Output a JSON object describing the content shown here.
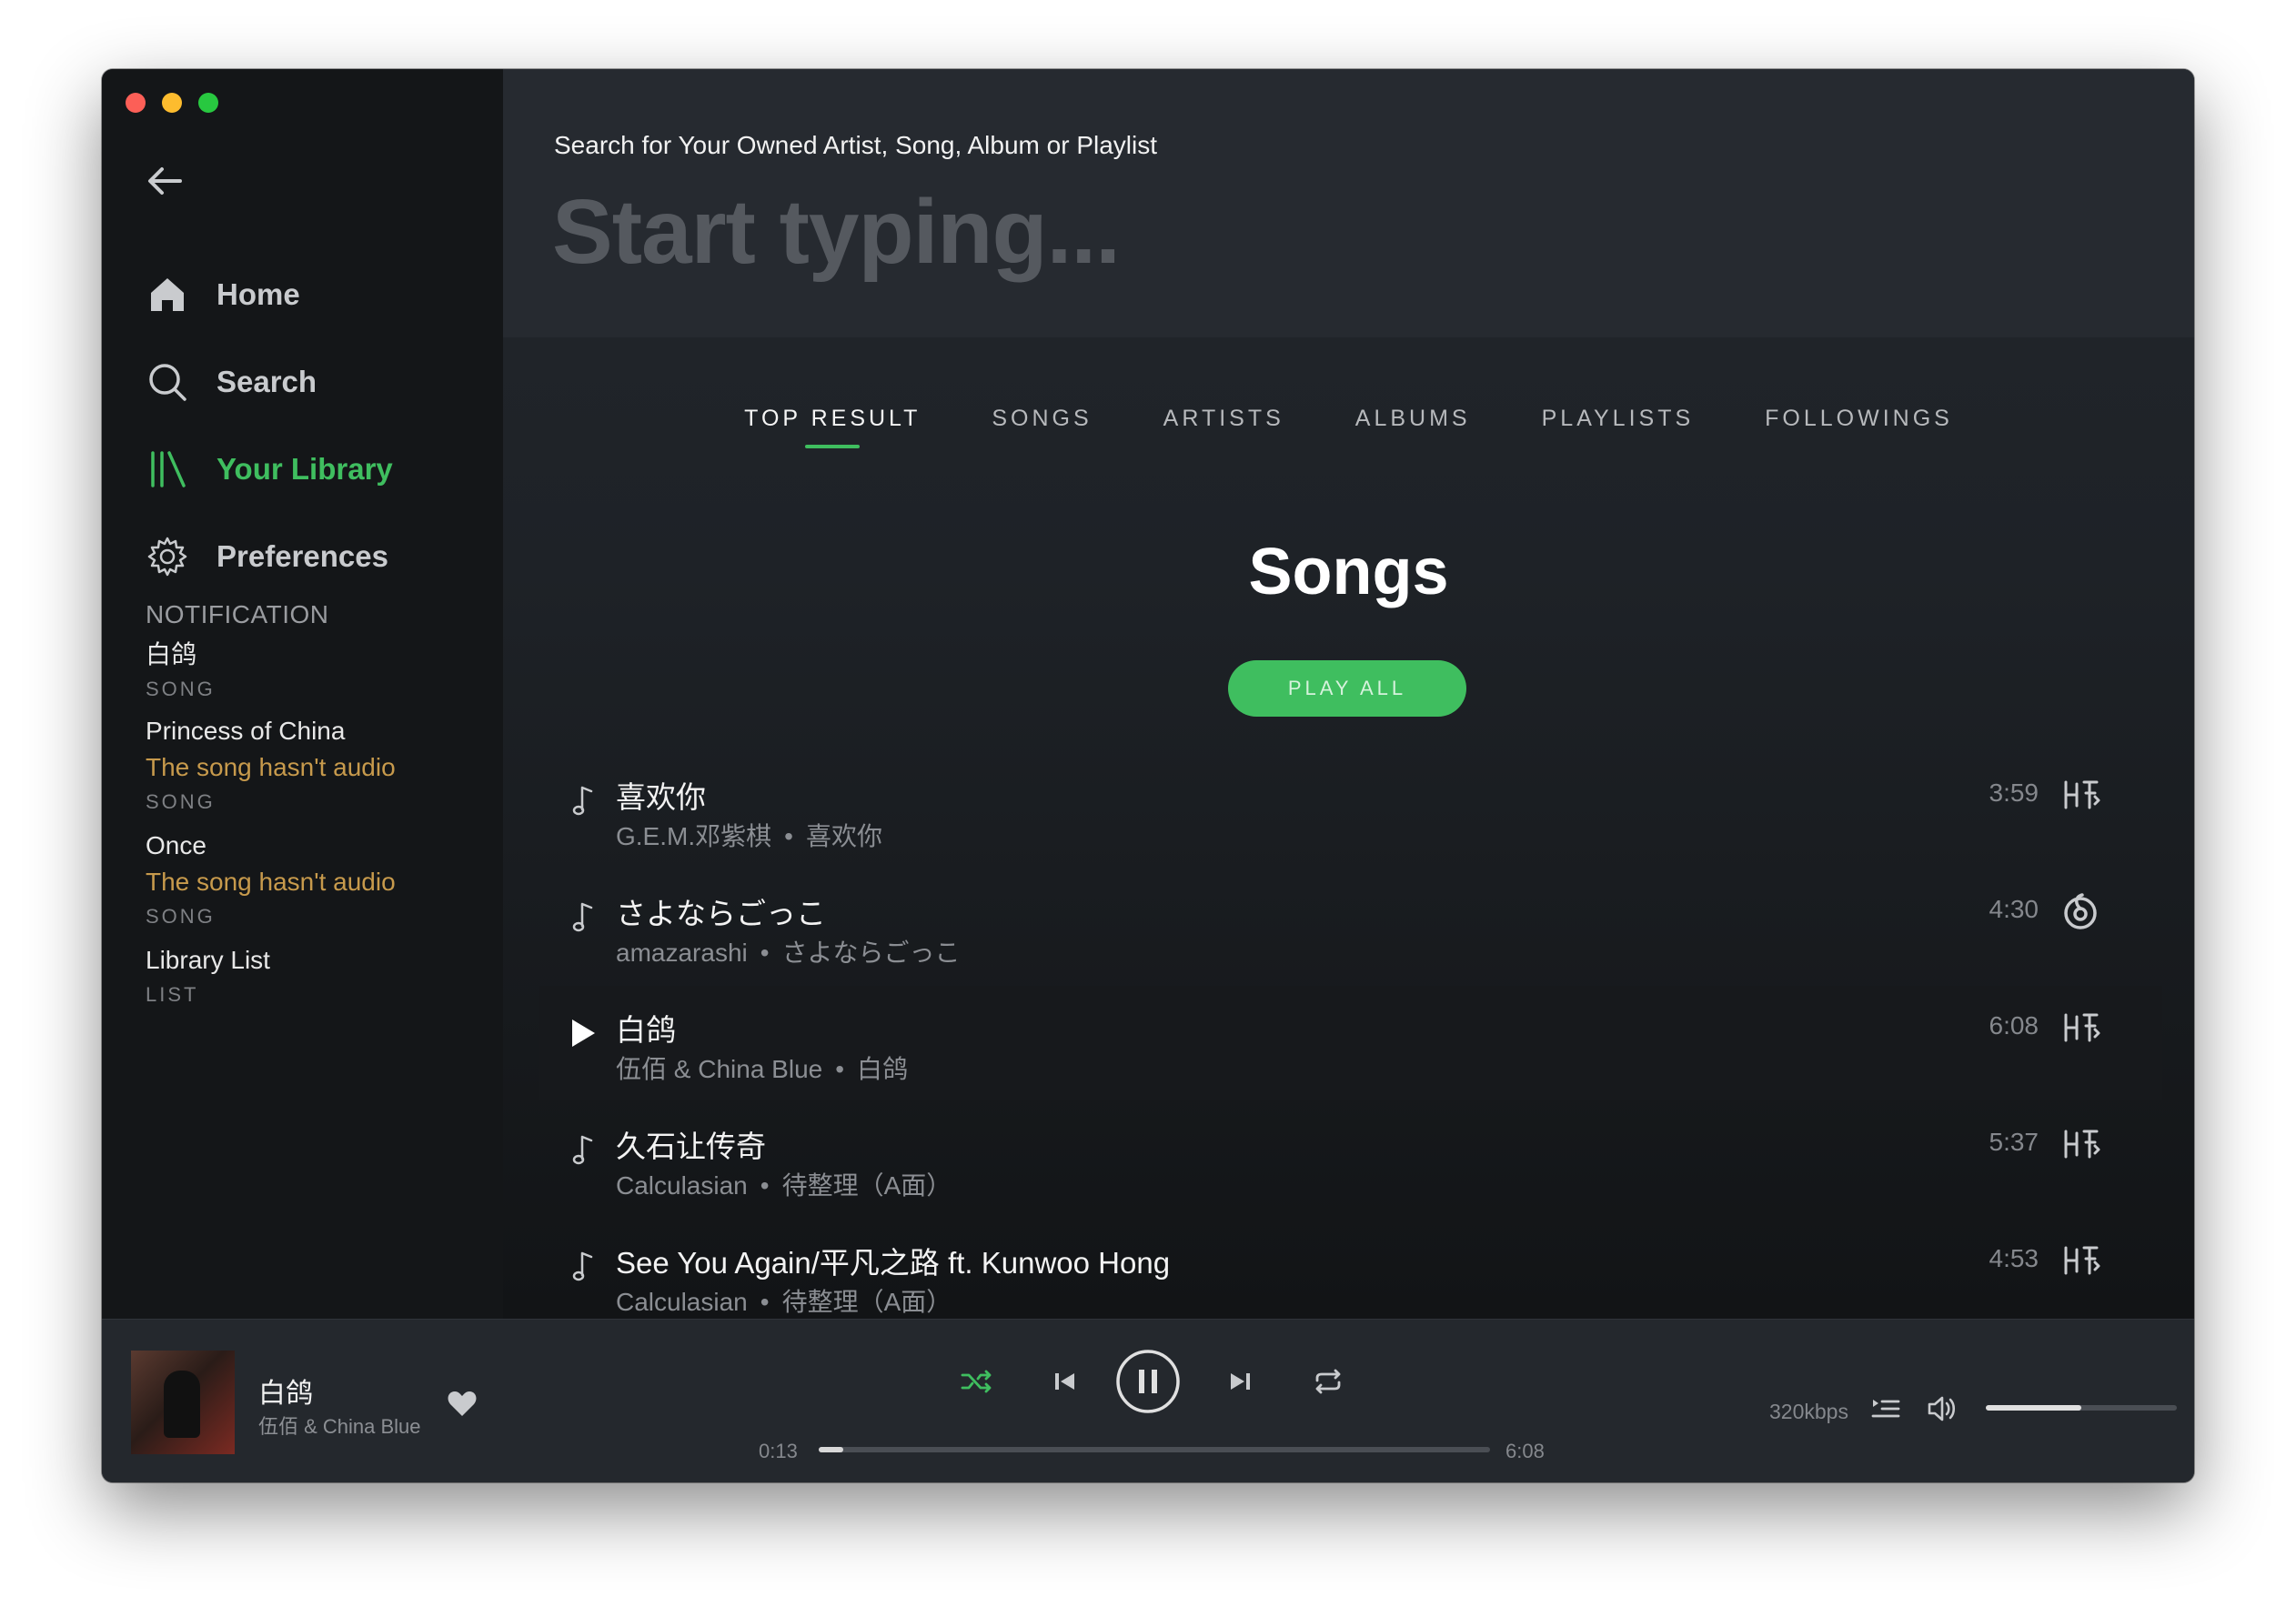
{
  "sidebar": {
    "nav": [
      {
        "label": "Home",
        "icon": "home-icon"
      },
      {
        "label": "Search",
        "icon": "search-icon"
      },
      {
        "label": "Your Library",
        "icon": "library-icon"
      },
      {
        "label": "Preferences",
        "icon": "gear-icon"
      }
    ],
    "notification_header": "NOTIFICATION",
    "notifications": [
      {
        "title": "白鸽",
        "kind": "SONG"
      },
      {
        "title": "Princess of China",
        "warning": "The song hasn't audio",
        "kind": "SONG"
      },
      {
        "title": "Once",
        "warning": "The song hasn't audio",
        "kind": "SONG"
      },
      {
        "title": "Library List",
        "kind": "LIST"
      }
    ]
  },
  "search": {
    "label": "Search for Your Owned Artist, Song, Album or Playlist",
    "placeholder": "Start typing..."
  },
  "tabs": [
    "TOP RESULT",
    "SONGS",
    "ARTISTS",
    "ALBUMS",
    "PLAYLISTS",
    "FOLLOWINGS"
  ],
  "active_tab": "TOP RESULT",
  "section_title": "Songs",
  "play_all_label": "PLAY ALL",
  "songs": [
    {
      "title": "喜欢你",
      "artist": "G.E.M.邓紫棋",
      "album": "喜欢你",
      "duration": "3:59",
      "source_icon": "xiami-icon"
    },
    {
      "title": "さよならごっこ",
      "artist": "amazarashi",
      "album": "さよならごっこ",
      "duration": "4:30",
      "source_icon": "netease-icon"
    },
    {
      "title": "白鸽",
      "artist": "伍佰 & China Blue",
      "album": "白鸽",
      "duration": "6:08",
      "source_icon": "xiami-icon",
      "playing": true
    },
    {
      "title": "久石让传奇",
      "artist": "Calculasian",
      "album": "待整理（A面）",
      "duration": "5:37",
      "source_icon": "xiami-icon"
    },
    {
      "title": "See You Again/平凡之路 ft. Kunwoo Hong",
      "artist": "Calculasian",
      "album": "待整理（A面）",
      "duration": "4:53",
      "source_icon": "xiami-icon"
    }
  ],
  "player": {
    "title": "白鸽",
    "artist": "伍佰 & China Blue",
    "elapsed": "0:13",
    "total": "6:08",
    "progress_fraction": 0.036,
    "bitrate": "320kbps",
    "volume_fraction": 0.5
  },
  "colors": {
    "accent": "#3fbe5f",
    "warning": "#c79a4c",
    "background": "#1c1f24"
  }
}
